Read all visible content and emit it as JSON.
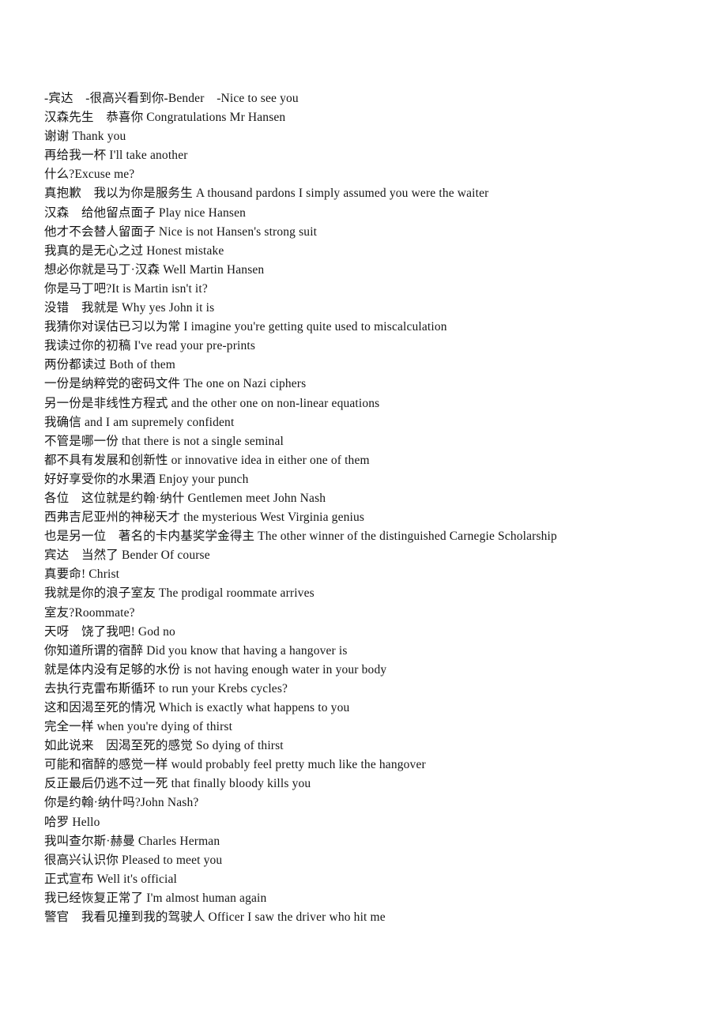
{
  "document": {
    "kind": "bilingual-subtitle-transcript",
    "language_pair": "Chinese-English",
    "background_color": "#ffffff",
    "text_color": "#151515",
    "lines": [
      "-宾达　-很高兴看到你-Bender　-Nice to see you",
      "汉森先生　恭喜你 Congratulations Mr Hansen",
      "谢谢 Thank you",
      "再给我一杯 I'll take another",
      "什么?Excuse me?",
      "真抱歉　我以为你是服务生 A thousand pardons I simply assumed you were the waiter",
      "汉森　给他留点面子 Play nice Hansen",
      "他才不会替人留面子 Nice is not Hansen's strong suit",
      "我真的是无心之过 Honest mistake",
      "想必你就是马丁·汉森 Well Martin Hansen",
      "你是马丁吧?It is Martin isn't it?",
      "没错　我就是 Why yes John it is",
      "我猜你对误估已习以为常 I imagine you're getting quite used to miscalculation",
      "我读过你的初稿 I've read your pre-prints",
      "两份都读过 Both of them",
      "一份是纳粹党的密码文件 The one on Nazi ciphers",
      "另一份是非线性方程式 and the other one on non-linear equations",
      "我确信 and I am supremely confident",
      "不管是哪一份 that there is not a single seminal",
      "都不具有发展和创新性 or innovative idea in either one of them",
      "好好享受你的水果酒 Enjoy your punch",
      "各位　这位就是约翰·纳什 Gentlemen meet John Nash",
      "西弗吉尼亚州的神秘天才 the mysterious West Virginia genius",
      "也是另一位　著名的卡内基奖学金得主 The other winner of the distinguished Carnegie Scholarship",
      "宾达　当然了 Bender Of course",
      "真要命! Christ",
      "我就是你的浪子室友 The prodigal roommate arrives",
      "室友?Roommate?",
      "天呀　饶了我吧! God no",
      "你知道所谓的宿醉 Did you know that having a hangover is",
      "就是体内没有足够的水份 is not having enough water in your body",
      "去执行克雷布斯循环 to run your Krebs cycles?",
      "这和因渴至死的情况 Which is exactly what happens to you",
      "完全一样 when you're dying of thirst",
      "如此说来　因渴至死的感觉 So dying of thirst",
      "可能和宿醉的感觉一样 would probably feel pretty much like the hangover",
      "反正最后仍逃不过一死 that finally bloody kills you",
      "你是约翰·纳什吗?John Nash?",
      "哈罗 Hello",
      "我叫查尔斯·赫曼 Charles Herman",
      "很高兴认识你 Pleased to meet you",
      "正式宣布 Well it's official",
      "我已经恢复正常了 I'm almost human again",
      "警官　我看见撞到我的驾驶人 Officer I saw the driver who hit me"
    ]
  }
}
